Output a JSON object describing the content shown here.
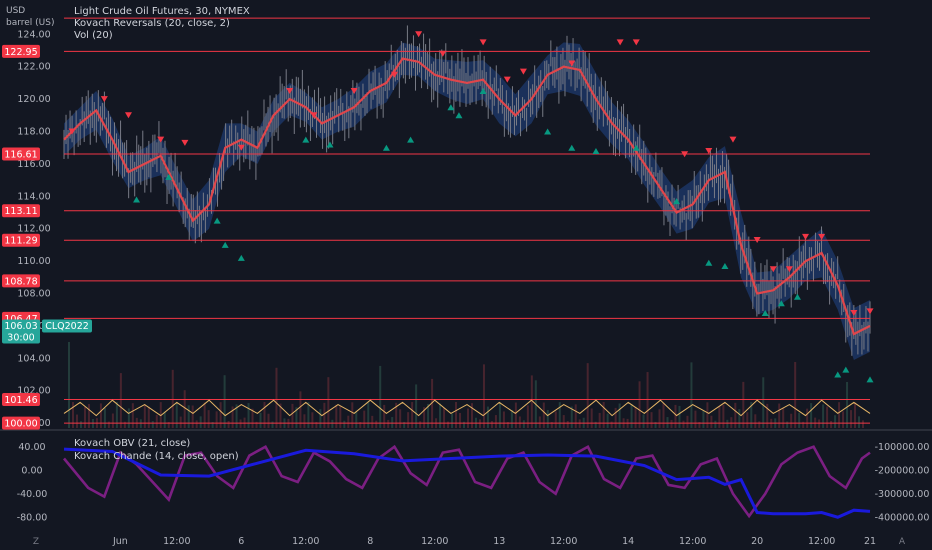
{
  "header": {
    "currency": "USD",
    "unit": "barrel (US)",
    "legend_main": "Light Crude Oil Futures, 30, NYMEX",
    "legend_reversals": "Kovach Reversals (20, close, 2)",
    "legend_vol": "Vol (20)",
    "legend_obv": "Kovach OBV (21, close)",
    "legend_chande": "Kovach Chande (14, close, open)"
  },
  "colors": {
    "background": "#131722",
    "level_line": "#f23645",
    "candle": "#787b86",
    "ma": "#e0464b",
    "band": "#1e3a6e",
    "up_marker": "#089981",
    "down_marker": "#f23645",
    "vol_osc": "#e6b566",
    "obv": "#1a1adc",
    "chande": "#7b1f82",
    "last_price_tag": "#26a69a"
  },
  "chart_data": [
    {
      "type": "line",
      "name": "price-pane",
      "y_range": [
        99.7,
        125.5
      ],
      "x_range": [
        0,
        100
      ],
      "y_ticks": [
        "124.00",
        "122.00",
        "120.00",
        "118.00",
        "116.00",
        "114.00",
        "112.00",
        "110.00",
        "108.00",
        "106.00",
        "104.00",
        "102.00",
        "100.00"
      ],
      "y_tick_values": [
        124,
        122,
        120,
        118,
        116,
        114,
        112,
        110,
        108,
        106,
        104,
        102,
        100
      ],
      "levels": [
        {
          "value": 125.0,
          "label": ""
        },
        {
          "value": 122.95,
          "label": "122.95"
        },
        {
          "value": 116.61,
          "label": "116.61"
        },
        {
          "value": 113.11,
          "label": "113.11"
        },
        {
          "value": 111.29,
          "label": "111.29"
        },
        {
          "value": 108.78,
          "label": "108.78"
        },
        {
          "value": 106.47,
          "label": "106.47"
        },
        {
          "value": 101.46,
          "label": "101.46"
        },
        {
          "value": 100.0,
          "label": "100.00"
        }
      ],
      "last_price": {
        "value": 106.03,
        "label": "106.03",
        "countdown": "30:00",
        "symbol": "CLQ2022"
      },
      "x_ticks": [
        {
          "x": 7,
          "label": "Jun"
        },
        {
          "x": 14,
          "label": "12:00"
        },
        {
          "x": 22,
          "label": "6"
        },
        {
          "x": 30,
          "label": "12:00"
        },
        {
          "x": 38,
          "label": "8"
        },
        {
          "x": 46,
          "label": "12:00"
        },
        {
          "x": 54,
          "label": "13"
        },
        {
          "x": 62,
          "label": "12:00"
        },
        {
          "x": 70,
          "label": "14"
        },
        {
          "x": 78,
          "label": "12:00"
        },
        {
          "x": 86,
          "label": "20"
        },
        {
          "x": 94,
          "label": "12:00"
        },
        {
          "x": 100,
          "label": "21"
        }
      ],
      "series": [
        {
          "kind": "moving-average",
          "x": [
            0,
            2,
            4,
            6,
            8,
            10,
            12,
            14,
            16,
            18,
            20,
            22,
            24,
            26,
            28,
            30,
            32,
            34,
            36,
            38,
            40,
            42,
            44,
            46,
            48,
            50,
            52,
            54,
            56,
            58,
            60,
            62,
            64,
            66,
            68,
            70,
            72,
            74,
            76,
            78,
            80,
            82,
            84,
            86,
            88,
            90,
            92,
            94,
            96,
            98,
            100
          ],
          "values": [
            117.5,
            118.5,
            119.3,
            117.5,
            115.5,
            116.0,
            116.5,
            114.5,
            112.5,
            113.5,
            117.0,
            117.5,
            117.0,
            119.0,
            120.0,
            119.5,
            118.5,
            119.0,
            119.5,
            120.5,
            121.0,
            122.5,
            122.3,
            121.5,
            121.2,
            121.0,
            121.2,
            120.0,
            119.0,
            120.0,
            121.5,
            122.0,
            121.8,
            120.0,
            118.5,
            117.5,
            116.0,
            114.5,
            113.0,
            113.5,
            115.0,
            115.5,
            111.0,
            108.0,
            108.2,
            109.0,
            110.0,
            110.5,
            108.5,
            105.5,
            106.0
          ]
        }
      ],
      "band_width": [
        1.0,
        1.0,
        1.2,
        1.3,
        1.0,
        1.0,
        1.2,
        1.2,
        1.3,
        1.5,
        1.5,
        1.0,
        1.0,
        1.0,
        1.0,
        0.9,
        1.0,
        1.0,
        1.2,
        1.2,
        1.2,
        1.0,
        0.9,
        1.0,
        1.2,
        1.3,
        1.2,
        1.5,
        1.3,
        1.5,
        1.2,
        1.5,
        1.6,
        1.6,
        1.3,
        1.2,
        1.3,
        1.2,
        1.3,
        1.5,
        1.4,
        1.6,
        2.0,
        1.3,
        1.2,
        1.3,
        1.2,
        1.5,
        1.5,
        1.6,
        1.6
      ],
      "down_markers": [
        [
          1,
          118
        ],
        [
          5,
          120
        ],
        [
          8,
          119
        ],
        [
          12,
          117.5
        ],
        [
          15,
          117.3
        ],
        [
          22,
          117
        ],
        [
          28,
          120.5
        ],
        [
          31,
          119
        ],
        [
          36,
          120.5
        ],
        [
          41,
          121.5
        ],
        [
          44,
          124
        ],
        [
          47,
          122.8
        ],
        [
          52,
          123.5
        ],
        [
          55,
          121.2
        ],
        [
          57,
          121.7
        ],
        [
          63,
          122.2
        ],
        [
          69,
          123.5
        ],
        [
          71,
          123.5
        ],
        [
          77,
          116.6
        ],
        [
          80,
          116.8
        ],
        [
          83,
          117.5
        ],
        [
          86,
          111.3
        ],
        [
          88,
          109.5
        ],
        [
          90,
          109.5
        ],
        [
          92,
          111.5
        ],
        [
          94,
          111.5
        ],
        [
          98,
          106.8
        ],
        [
          100,
          106.9
        ]
      ],
      "up_markers": [
        [
          9,
          113.8
        ],
        [
          13,
          115.2
        ],
        [
          19,
          112.5
        ],
        [
          20,
          111.0
        ],
        [
          22,
          110.2
        ],
        [
          30,
          117.5
        ],
        [
          33,
          117.2
        ],
        [
          40,
          117.0
        ],
        [
          43,
          117.5
        ],
        [
          48,
          119.5
        ],
        [
          49,
          119.0
        ],
        [
          52,
          120.5
        ],
        [
          60,
          118.0
        ],
        [
          63,
          117.0
        ],
        [
          66,
          116.8
        ],
        [
          71,
          117.0
        ],
        [
          76,
          113.7
        ],
        [
          80,
          109.9
        ],
        [
          82,
          109.7
        ],
        [
          87,
          106.8
        ],
        [
          89,
          107.4
        ],
        [
          91,
          107.8
        ],
        [
          96,
          103.0
        ],
        [
          97,
          103.3
        ],
        [
          100,
          102.7
        ]
      ]
    },
    {
      "type": "line",
      "name": "volume-oscillator",
      "values": [
        0.3,
        0.8,
        0.2,
        0.9,
        0.3,
        0.7,
        0.2,
        0.8,
        0.3,
        0.9,
        0.2,
        0.7,
        0.3,
        0.9,
        0.2,
        0.8,
        0.2,
        0.7,
        0.3,
        0.9,
        0.3,
        0.8,
        0.2,
        0.9,
        0.3,
        0.7,
        0.2,
        0.8,
        0.3,
        0.9,
        0.2,
        0.7,
        0.3,
        0.9,
        0.2,
        0.8,
        0.3,
        0.9,
        0.2,
        0.7,
        0.3,
        0.8,
        0.2,
        0.9,
        0.3,
        0.7,
        0.2,
        0.9,
        0.3,
        0.8,
        0.3
      ]
    },
    {
      "type": "line",
      "name": "indicator-pane",
      "left_ticks": [
        "40.00",
        "0.00",
        "-40.00",
        "-80.00"
      ],
      "left_tick_values": [
        40,
        0,
        -40,
        -80
      ],
      "left_range": [
        -100,
        60
      ],
      "right_ticks": [
        "-100000.00",
        "-200000.00",
        "-300000.00",
        "-400000.00"
      ],
      "right_tick_values": [
        -100000,
        -200000,
        -300000,
        -400000
      ],
      "right_range": [
        -450000,
        -50000
      ],
      "series": [
        {
          "kind": "obv",
          "axis": "right",
          "x": [
            0,
            6,
            12,
            18,
            24,
            30,
            36,
            42,
            48,
            54,
            60,
            66,
            72,
            76,
            78,
            80,
            82,
            84,
            86,
            88,
            90,
            92,
            94,
            96,
            98,
            100
          ],
          "values": [
            -110000,
            -120000,
            -220000,
            -225000,
            -170000,
            -115000,
            -130000,
            -160000,
            -150000,
            -140000,
            -135000,
            -140000,
            -180000,
            -240000,
            -235000,
            -230000,
            -260000,
            -240000,
            -380000,
            -385000,
            -385000,
            -385000,
            -380000,
            -400000,
            -370000,
            -375000
          ]
        },
        {
          "kind": "chande",
          "axis": "left",
          "x": [
            0,
            3,
            5,
            7,
            9,
            11,
            13,
            15,
            17,
            19,
            21,
            23,
            25,
            27,
            29,
            31,
            33,
            35,
            37,
            39,
            41,
            43,
            45,
            47,
            49,
            51,
            53,
            55,
            57,
            59,
            61,
            63,
            65,
            67,
            69,
            71,
            73,
            75,
            77,
            79,
            81,
            83,
            85,
            87,
            89,
            91,
            93,
            95,
            97,
            99,
            100
          ],
          "values": [
            20,
            -30,
            -45,
            30,
            10,
            -20,
            -50,
            25,
            30,
            -10,
            -30,
            25,
            40,
            -10,
            -20,
            30,
            15,
            -15,
            -30,
            20,
            40,
            -5,
            -25,
            30,
            35,
            -20,
            -30,
            20,
            30,
            -20,
            -40,
            25,
            40,
            -15,
            -30,
            20,
            25,
            -25,
            -30,
            10,
            20,
            -40,
            -78,
            -40,
            10,
            30,
            40,
            -10,
            -30,
            20,
            30
          ]
        }
      ]
    }
  ],
  "bottom_markers": {
    "left": "Z",
    "right": "A"
  }
}
